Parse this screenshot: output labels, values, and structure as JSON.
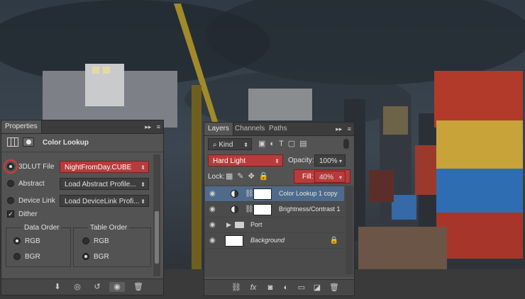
{
  "properties": {
    "tab": "Properties",
    "title": "Color Lookup",
    "rows": [
      {
        "label": "3DLUT File",
        "value": "NightFromDay.CUBE",
        "selected": true
      },
      {
        "label": "Abstract",
        "value": "Load Abstract Profile...",
        "selected": false
      },
      {
        "label": "Device Link",
        "value": "Load DeviceLink Profi...",
        "selected": false
      }
    ],
    "dither_label": "Dither",
    "data_order": {
      "title": "Data Order",
      "options": [
        "RGB",
        "BGR"
      ]
    },
    "table_order": {
      "title": "Table Order",
      "options": [
        "RGB",
        "BGR"
      ]
    }
  },
  "layers_panel": {
    "tabs": [
      "Layers",
      "Channels",
      "Paths"
    ],
    "filter_kind": "Kind",
    "blend_mode": "Hard Light",
    "opacity_label": "Opacity:",
    "opacity_value": "100%",
    "lock_label": "Lock:",
    "fill_label": "Fill:",
    "fill_value": "40%",
    "layers": [
      {
        "name": "Color Lookup 1 copy"
      },
      {
        "name": "Brightness/Contrast 1"
      },
      {
        "name": "Port"
      },
      {
        "name": "Background"
      }
    ]
  },
  "colors": {
    "accent_red": "#b83b3b",
    "selection_blue": "#4f6a8a",
    "panel": "#535353"
  }
}
